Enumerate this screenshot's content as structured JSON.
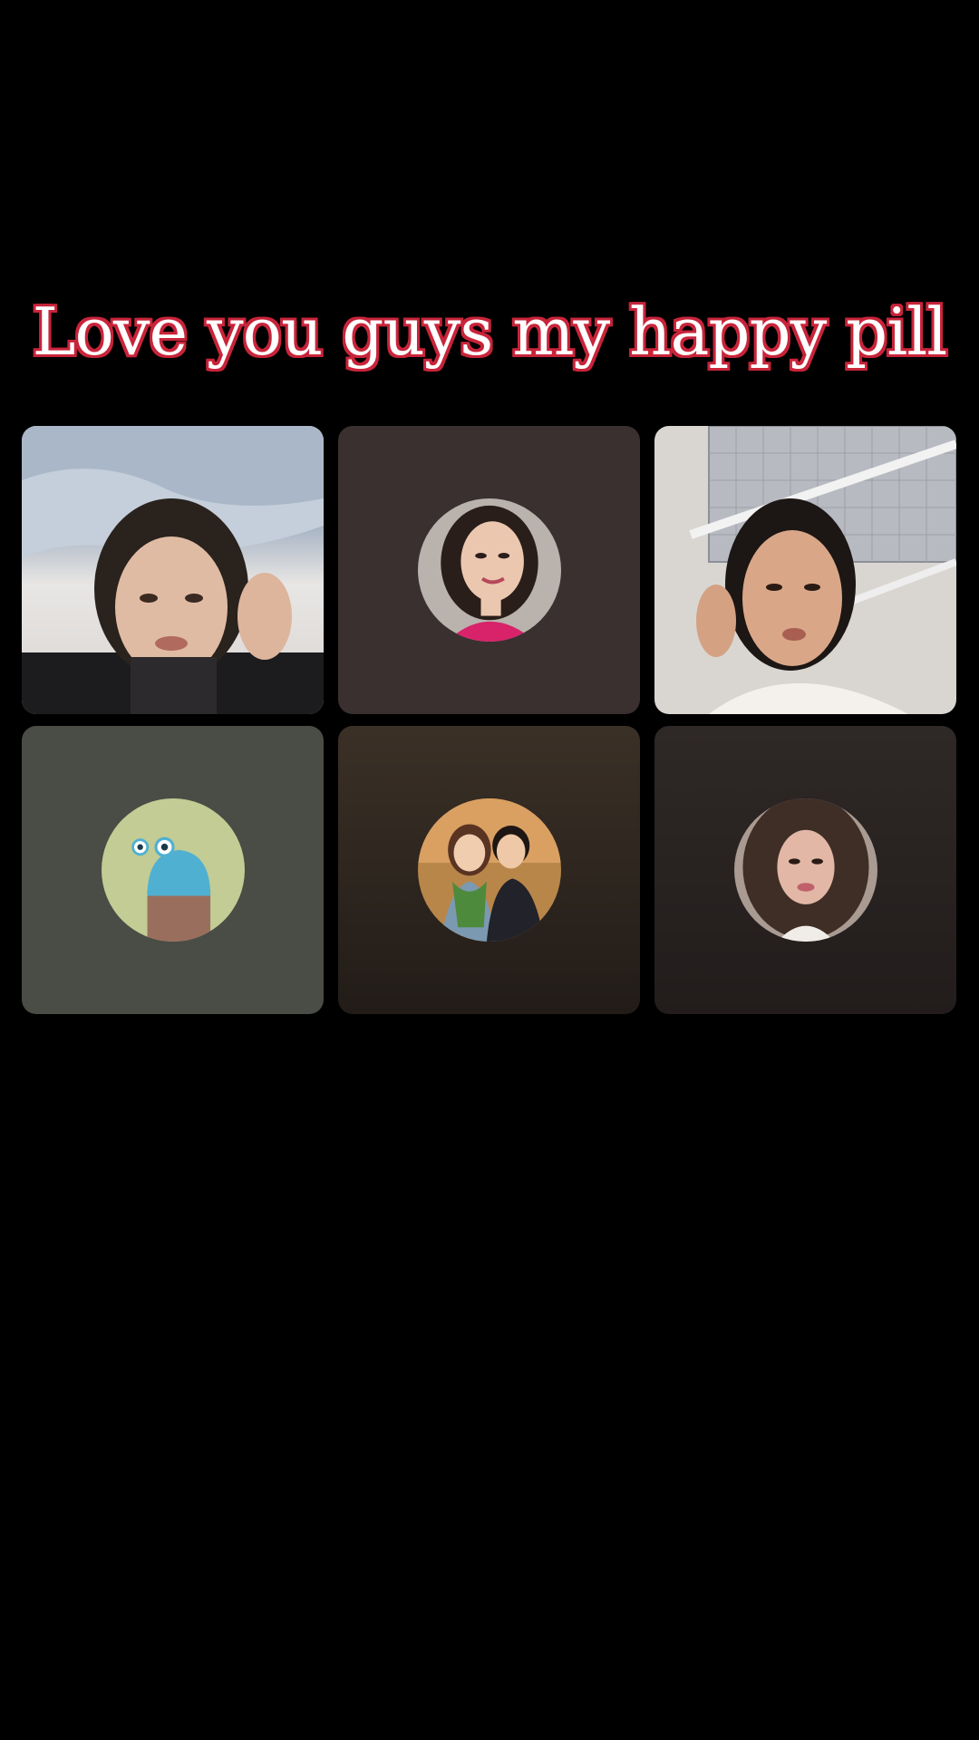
{
  "caption": {
    "text": "Love you guys my happy pill"
  },
  "colors": {
    "background": "#000000",
    "caption_fill": "#ffffff",
    "caption_outline": "#c8243a"
  },
  "participants": [
    {
      "kind": "video",
      "description": "participant-video-1"
    },
    {
      "kind": "avatar",
      "tile_color": "#3a3030",
      "avatar": "profile-photo-woman"
    },
    {
      "kind": "video",
      "description": "participant-video-2"
    },
    {
      "kind": "avatar",
      "tile_color": "#4a4c46",
      "avatar": "cartoon-blue-creature"
    },
    {
      "kind": "avatar",
      "tile_color": "#2e2620",
      "avatar": "illustrated-couple"
    },
    {
      "kind": "avatar",
      "tile_color": "#2a2422",
      "avatar": "profile-photo-woman-2"
    }
  ]
}
